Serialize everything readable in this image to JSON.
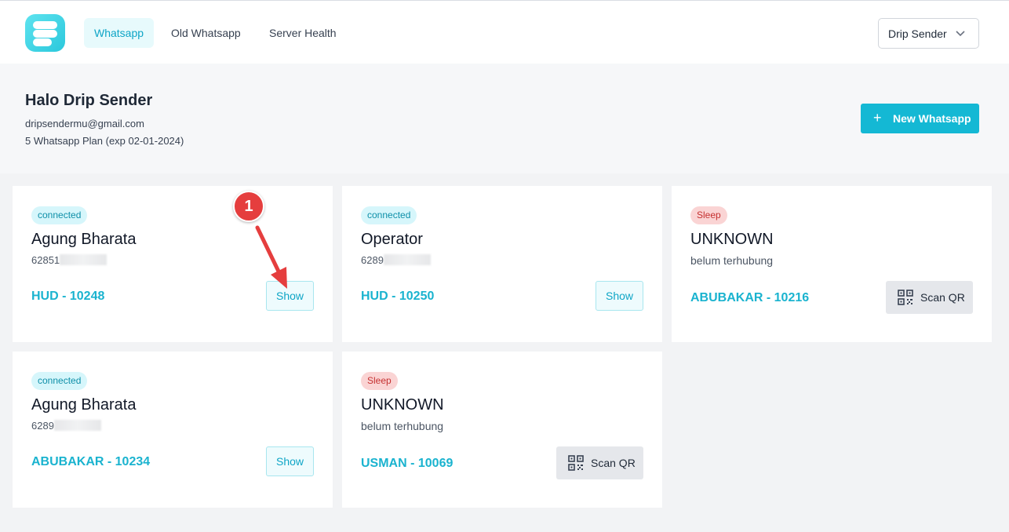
{
  "nav": {
    "tabs": [
      {
        "label": "Whatsapp",
        "active": true
      },
      {
        "label": "Old Whatsapp",
        "active": false
      },
      {
        "label": "Server Health",
        "active": false
      }
    ],
    "account_label": "Drip Sender",
    "logo_icon": "dripsender-logo-icon"
  },
  "header": {
    "greeting": "Halo Drip Sender",
    "email": "dripsendermu@gmail.com",
    "plan": "5 Whatsapp Plan (exp 02-01-2024)",
    "new_button": {
      "icon": "+",
      "label": "New Whatsapp"
    }
  },
  "devices": [
    {
      "status": "connected",
      "name": "Agung Bharata",
      "number": "62851",
      "code": "HUD - 10248",
      "action": "Show"
    },
    {
      "status": "connected",
      "name": "Operator",
      "number": "6289",
      "code": "HUD - 10250",
      "action": "Show"
    },
    {
      "status": "Sleep",
      "name": "UNKNOWN",
      "subtitle": "belum terhubung",
      "code": "ABUBAKAR - 10216",
      "action": "Scan QR"
    },
    {
      "status": "connected",
      "name": "Agung Bharata",
      "number": "6289",
      "code": "ABUBAKAR - 10234",
      "action": "Show"
    },
    {
      "status": "Sleep",
      "name": "UNKNOWN",
      "subtitle": "belum terhubung",
      "code": "USMAN - 10069",
      "action": "Scan QR"
    }
  ],
  "annotation": {
    "number": "1"
  },
  "colors": {
    "accent": "#14b8d4",
    "connected_badge_bg": "#d6f6fb",
    "sleep_badge_bg": "#fad4d4",
    "annotation_red": "#e53e3e"
  }
}
